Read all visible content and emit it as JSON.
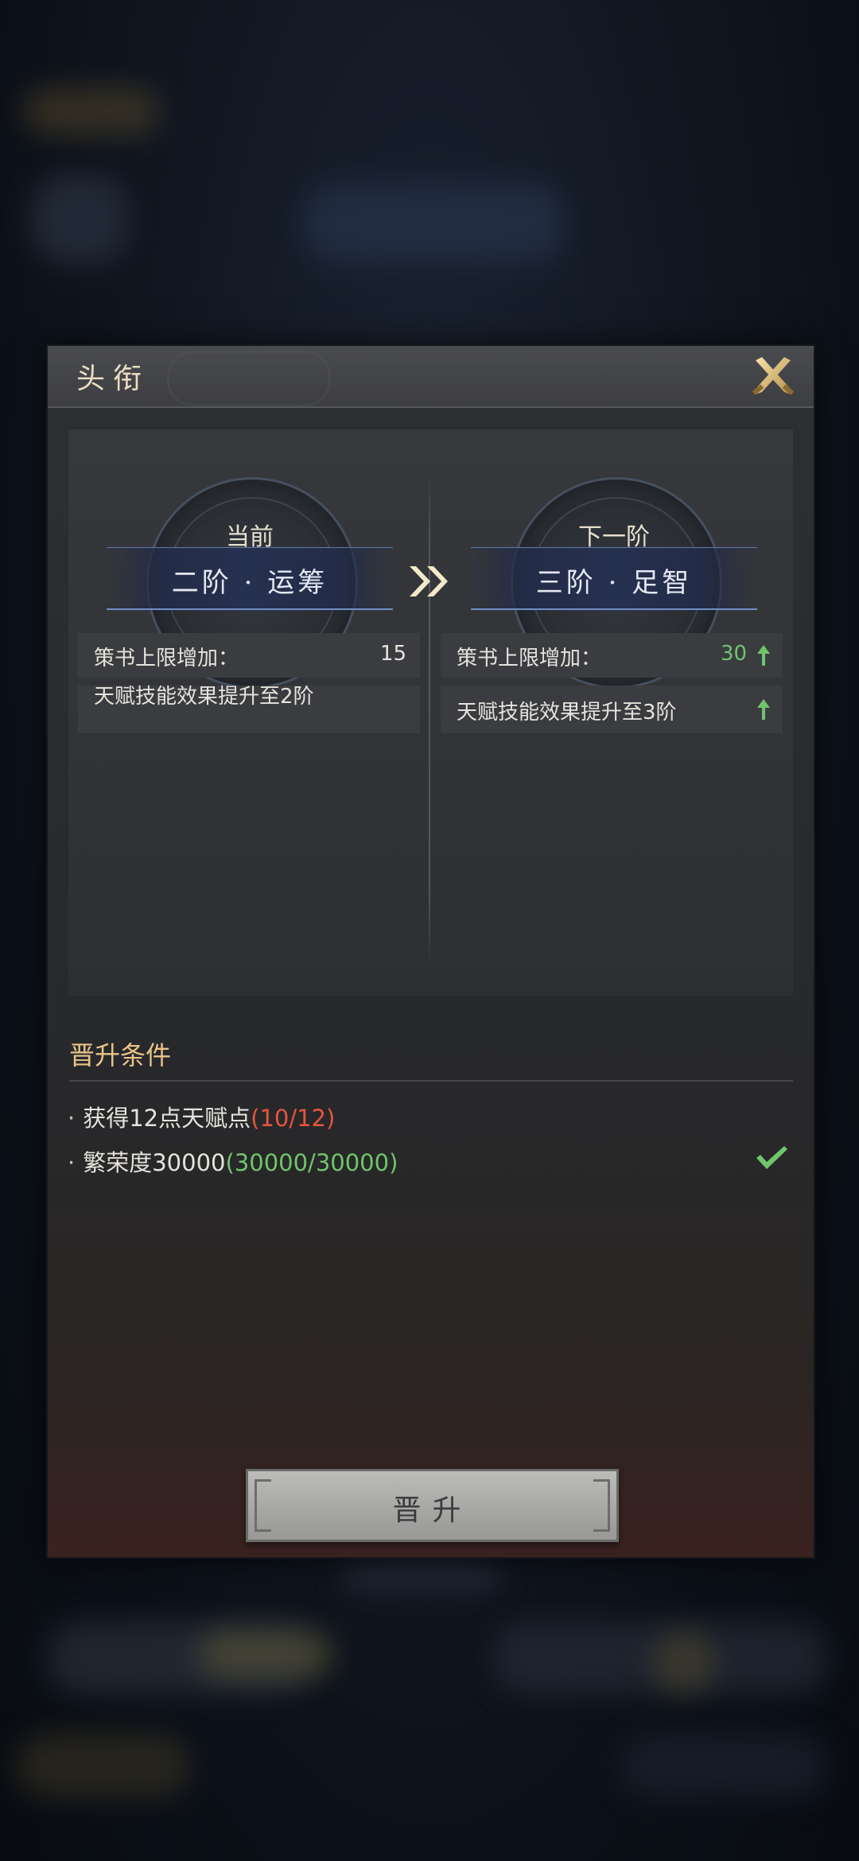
{
  "modal": {
    "title": "头衔"
  },
  "current": {
    "caption": "当前",
    "tier_name": "二阶 · 运筹",
    "stats": [
      {
        "label": "策书上限增加：",
        "value": "15"
      },
      {
        "label": "天赋技能效果提升至2阶",
        "value": ""
      }
    ]
  },
  "next": {
    "caption": "下一阶",
    "tier_name": "三阶 · 足智",
    "stats": [
      {
        "label": "策书上限增加：",
        "value": "30"
      },
      {
        "label": "天赋技能效果提升至3阶",
        "value": ""
      }
    ]
  },
  "conditions": {
    "title": "晋升条件",
    "items": [
      {
        "bullet": "·",
        "text": "获得12点天赋点",
        "progress": "(10/12)",
        "met": false
      },
      {
        "bullet": "·",
        "text": "繁荣度30000",
        "progress": "(30000/30000)",
        "met": true
      }
    ]
  },
  "promote_button": {
    "label": "晋升"
  },
  "colors": {
    "accent_gold": "#e8c587",
    "unmet_red": "#e5553d",
    "met_green": "#6fc56b",
    "tier_band_blue": "#263150"
  },
  "icons": {
    "close": "crossed-blades-close-icon",
    "arrow": "double-chevron-right-icon",
    "upgrade": "green-up-arrow-icon",
    "met": "checkmark-icon"
  }
}
